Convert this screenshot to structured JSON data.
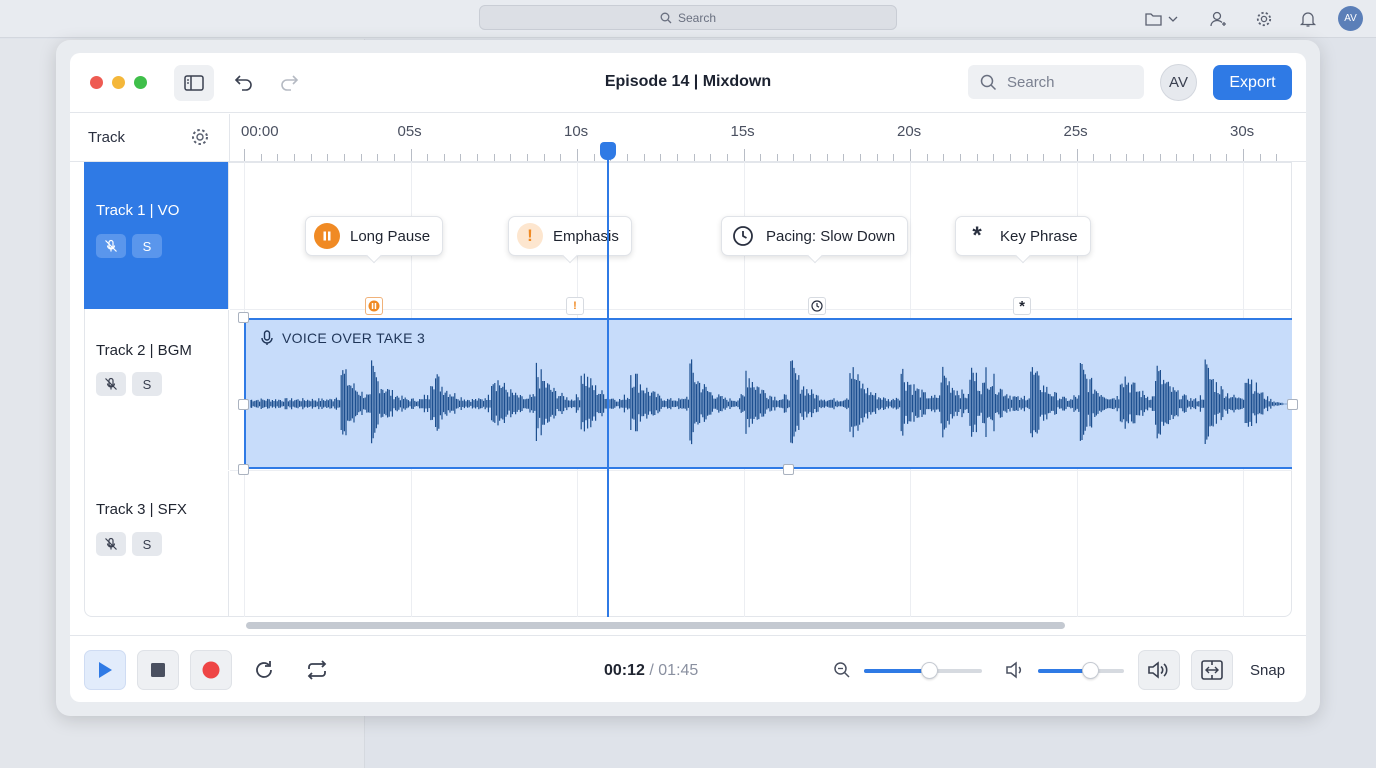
{
  "os": {
    "search_label": "Search",
    "avatar": "AV"
  },
  "window": {
    "title": "Episode 14 | Mixdown",
    "search_placeholder": "Search",
    "avatar": "AV",
    "export_label": "Export"
  },
  "tracks_header": {
    "label": "Track"
  },
  "tracks": [
    {
      "name": "Track 1 | VO",
      "mute": "",
      "solo": "S",
      "selected": true
    },
    {
      "name": "Track 2 | BGM",
      "mute": "",
      "solo": "S",
      "selected": false
    },
    {
      "name": "Track 3 | SFX",
      "mute": "",
      "solo": "S",
      "selected": false
    }
  ],
  "ruler": {
    "labels": [
      "00:00",
      "05s",
      "10s",
      "15s",
      "20s",
      "25s",
      "30s"
    ]
  },
  "markers": [
    {
      "label": "Long Pause",
      "icon": "pause-icon",
      "color": "#f08a24"
    },
    {
      "label": "Emphasis",
      "icon": "exclamation-icon",
      "color": "#f08a24"
    },
    {
      "label": "Pacing: Slow Down",
      "icon": "clock-icon",
      "color": "#2a3040"
    },
    {
      "label": "Key Phrase",
      "icon": "asterisk-icon",
      "color": "#2a3040"
    }
  ],
  "clip": {
    "title": "VOICE OVER TAKE 3"
  },
  "transport": {
    "current_time": "00:12",
    "separator": " / ",
    "total_time": "01:45",
    "zoom_level": 0.55,
    "volume_level": 0.6,
    "snap_label": "Snap"
  },
  "colors": {
    "accent": "#2f7ae5",
    "marker_orange": "#f08a24",
    "waveform": "#1d4f8f"
  }
}
